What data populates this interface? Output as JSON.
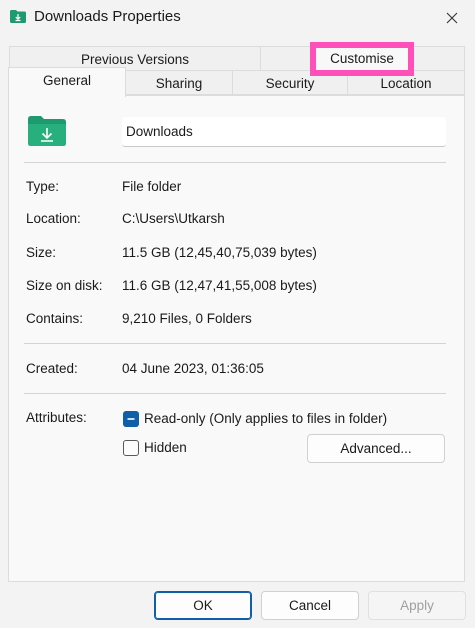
{
  "window": {
    "title": "Downloads Properties"
  },
  "tabs": {
    "previous_versions": "Previous Versions",
    "customise": "Customise",
    "general": "General",
    "sharing": "Sharing",
    "security": "Security",
    "location": "Location"
  },
  "general": {
    "folder_name": "Downloads",
    "type_label": "Type:",
    "type_value": "File folder",
    "location_label": "Location:",
    "location_value": "C:\\Users\\Utkarsh",
    "size_label": "Size:",
    "size_value": "11.5 GB (12,45,40,75,039 bytes)",
    "size_on_disk_label": "Size on disk:",
    "size_on_disk_value": "11.6 GB (12,47,41,55,008 bytes)",
    "contains_label": "Contains:",
    "contains_value": "9,210 Files, 0 Folders",
    "created_label": "Created:",
    "created_value": "04 June 2023, 01:36:05",
    "attributes_label": "Attributes:",
    "readonly_label": "Read-only (Only applies to files in folder)",
    "readonly_checked": true,
    "hidden_label": "Hidden",
    "hidden_checked": false,
    "advanced_label": "Advanced..."
  },
  "footer": {
    "ok_label": "OK",
    "cancel_label": "Cancel",
    "apply_label": "Apply"
  },
  "colors": {
    "folder": "#1f9a6e",
    "accent": "#0f5ea8",
    "highlight": "#ff4fb8"
  },
  "icons": {
    "title": "folder-download-icon",
    "close": "close-icon",
    "folder": "folder-download-icon"
  }
}
